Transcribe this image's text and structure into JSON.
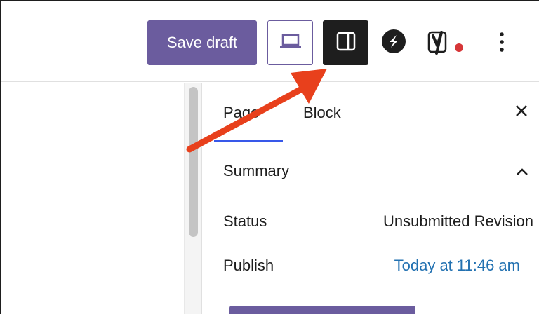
{
  "toolbar": {
    "save_label": "Save draft",
    "preview_icon": "laptop-icon",
    "settings_icon": "sidebar-panel-icon",
    "s_icon": "s-logo-icon",
    "yoast_icon": "yoast-y-icon",
    "yoast_dot_color": "#d63638",
    "more_icon": "vertical-ellipsis-icon",
    "accent": "#6b5c9e"
  },
  "sidebar": {
    "tabs": [
      {
        "label": "Page",
        "active": true
      },
      {
        "label": "Block",
        "active": false
      }
    ],
    "close_icon": "close-icon",
    "summary": {
      "title": "Summary",
      "toggle_icon": "chevron-up-icon",
      "rows": [
        {
          "label": "Status",
          "value": "Unsubmitted Revision"
        },
        {
          "label": "Publish",
          "value": "Today at 11:46 am"
        }
      ]
    },
    "link_color": "#2271b1"
  },
  "annotation": {
    "arrow_color": "#e8401c",
    "points_to": "settings-toggle-button"
  }
}
